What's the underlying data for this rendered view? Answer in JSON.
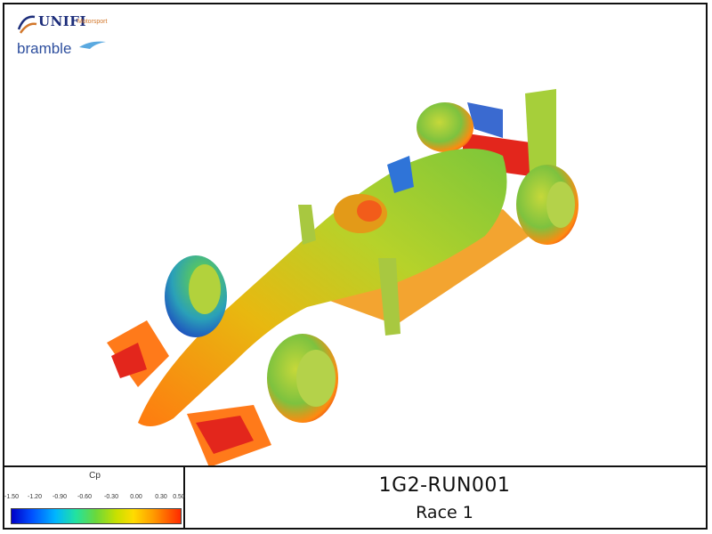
{
  "logo": {
    "primary": "UNIFI",
    "secondary": "Motorsport",
    "brand": "bramble"
  },
  "legend": {
    "title": "Cp",
    "ticks": [
      "-1.50",
      "-1.20",
      "-0.90",
      "-0.60",
      "-0.30",
      "0.00",
      "0.30",
      "0.50"
    ]
  },
  "run": {
    "title": "1G2-RUN001",
    "subtitle": "Race 1"
  },
  "colors": {
    "low": "#0000c8",
    "mid": "#6cd83a",
    "high": "#ff2a00",
    "body": "#c9d82a"
  }
}
